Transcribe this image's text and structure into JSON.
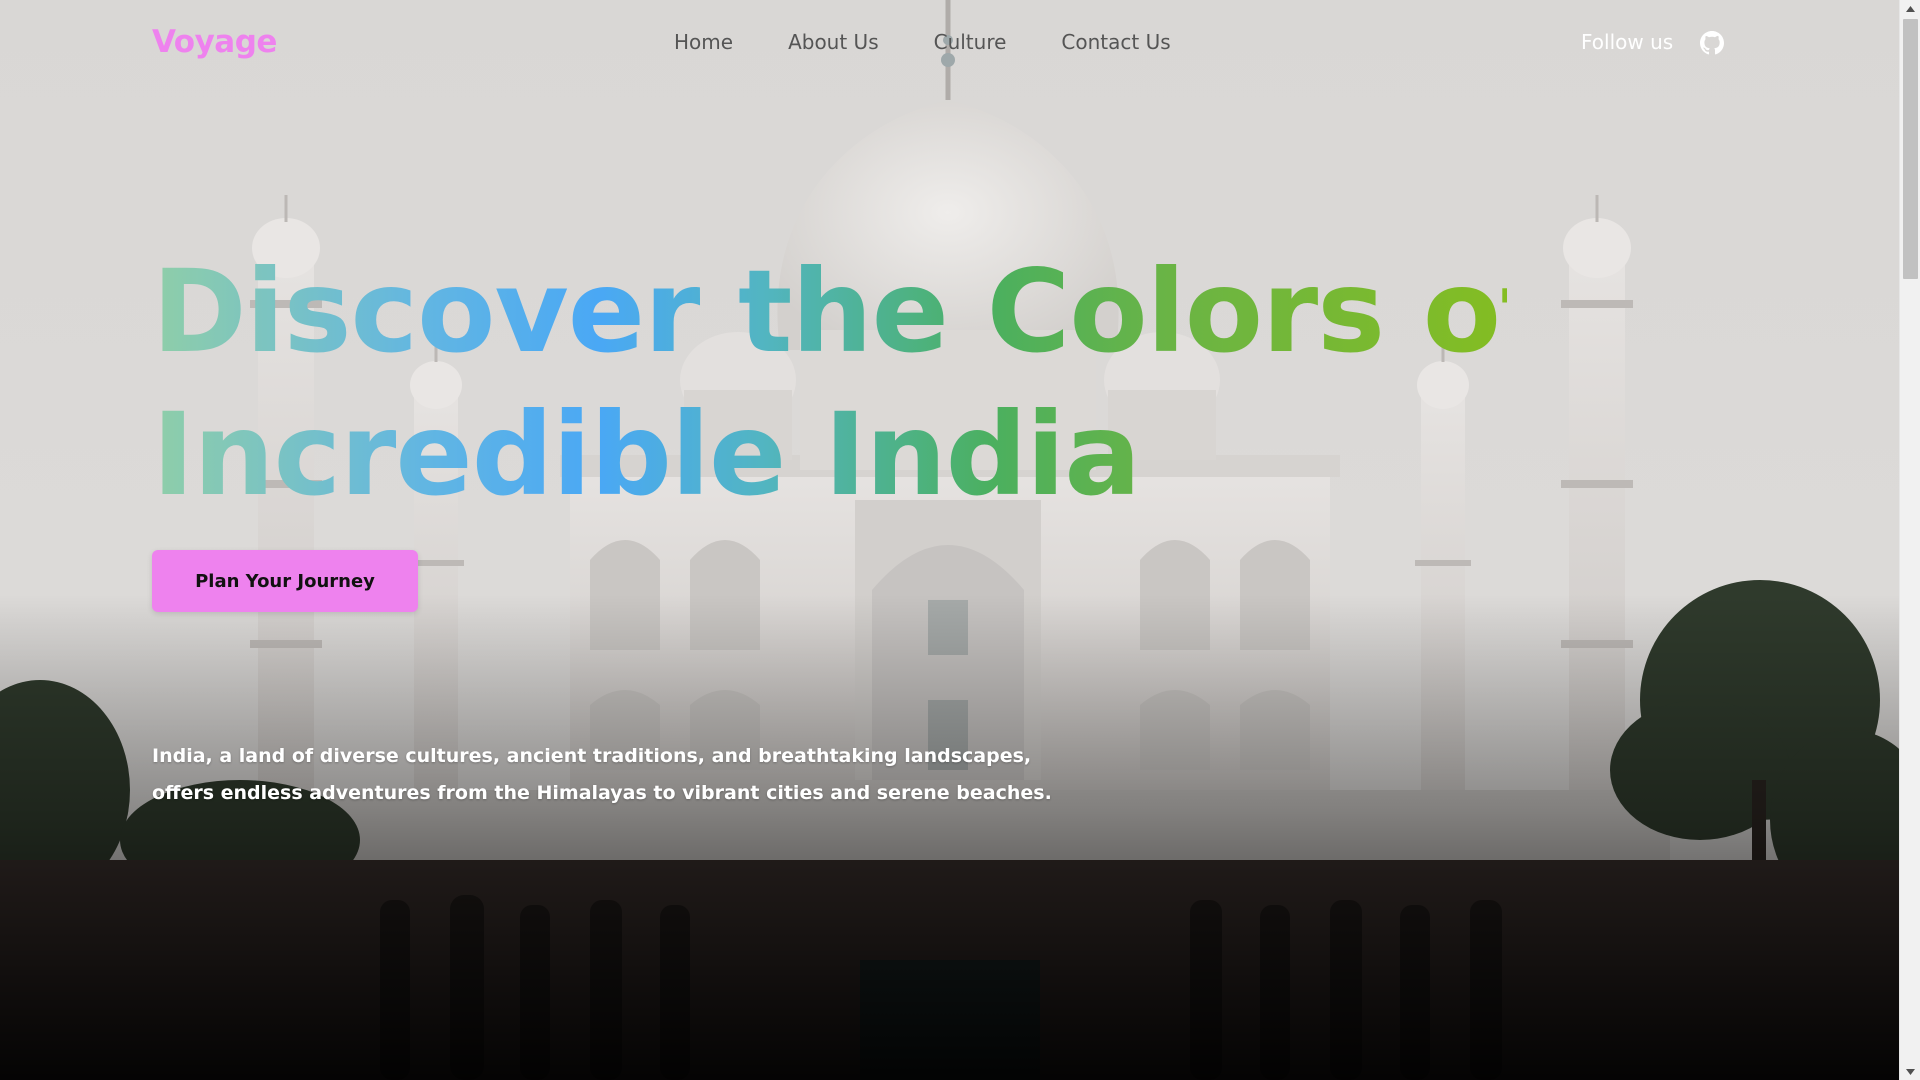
{
  "site": {
    "logo": "Voyage",
    "brand_color": "#ee82ee"
  },
  "nav": {
    "links": [
      {
        "label": "Home"
      },
      {
        "label": "About Us"
      },
      {
        "label": "Culture"
      },
      {
        "label": "Contact Us"
      }
    ],
    "follow_text": "Follow us",
    "social_icon": "github-icon"
  },
  "hero": {
    "title_line1": "Discover the Colors of",
    "title_line2": "Incredible India",
    "title_gradient": [
      "#8fcea8",
      "#4aa8f5",
      "#4bb05f",
      "#84bd22"
    ],
    "cta_label": "Plan Your Journey",
    "description": "India, a land of diverse cultures, ancient traditions, and breathtaking landscapes, offers endless adventures from the Himalayas to vibrant cities and serene beaches.",
    "background_image": "taj-mahal-photo"
  }
}
